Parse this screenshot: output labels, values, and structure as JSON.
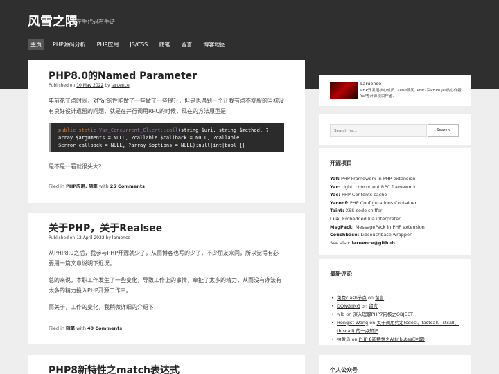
{
  "site": {
    "title": "风雪之隅",
    "description": "左手代码右手诗"
  },
  "nav": {
    "items": [
      {
        "label": "主页",
        "active": true
      },
      {
        "label": "PHP源码分析"
      },
      {
        "label": "PHP应用"
      },
      {
        "label": "JS/CSS"
      },
      {
        "label": "随笔"
      },
      {
        "label": "留言"
      },
      {
        "label": "博客地图"
      }
    ]
  },
  "posts": [
    {
      "title": "PHP8.0的Named Parameter",
      "meta_prefix": "Published on",
      "date": "10 May 2022",
      "meta_by": "by",
      "author": "laruence",
      "paragraphs": [
        "年前花了点时间，对Yar的性能做了一些做了一些提升，但是也遇到一个让我有点不舒服的当初没有良好设计遗留的问题，就是在并行调用RPC的时候，现在的方法原型是:"
      ],
      "code": {
        "line1_kw": "public static",
        "line1_fn": "Yar_Concurrent_Client::call",
        "line1_rest": "(string $uri, string $method, ?array $arguments = NULL, ?callable $callback = NULL, ?callable $error_callback = NULL, ?array $options = NULL):null|int|bool {}"
      },
      "after_code": "是不是一看就很头大？",
      "footer_prefix": "Filed in",
      "footer_cats": "PHP应用, 随笔",
      "footer_with": "with",
      "footer_comments": "25 Comments"
    },
    {
      "title": "关于PHP，关于Realsee",
      "meta_prefix": "Published on",
      "date": "12 April 2022",
      "meta_by": "by",
      "author": "laruence",
      "paragraphs": [
        "从PHP8.0之后，我参与PHP开源就少了，从而博客也写的少了，不少朋友来问，所以觉得有必要用一篇文章说明下近况。",
        "总的来说，本职工作发生了一些变化，导致工作上的事情，牵扯了太多的精力，从而没有办法有太多的精力投入PHP开源工作中。",
        "而关于，工作的变化，我稍微详细的介绍下:"
      ],
      "footer_prefix": "Filed in",
      "footer_cats": "随笔",
      "footer_with": "with",
      "footer_comments": "40 Comments"
    },
    {
      "title": "PHP8新特性之match表达式"
    }
  ],
  "sidebar": {
    "profile": {
      "name": "Laruence",
      "description": "PHP开发组核心成员, Zend顾问, PHP7及PHP8 JIT核心作者, Yaf等开源项目作者."
    },
    "search": {
      "placeholder": "Search for...",
      "button": "Search"
    },
    "projects": {
      "title": "开源项目",
      "items": [
        {
          "name": "Yaf:",
          "desc": "PHP Framework in PHP extension"
        },
        {
          "name": "Yar:",
          "desc": "Light, concurrent RPC framework"
        },
        {
          "name": "Yac:",
          "desc": "PHP Contents cache"
        },
        {
          "name": "Yaconf:",
          "desc": "PHP Configurations Container"
        },
        {
          "name": "Taint:",
          "desc": "XSS code sniffer"
        },
        {
          "name": "Lua:",
          "desc": "Embedded lua interpreter"
        },
        {
          "name": "MsgPack:",
          "desc": "MessagePack in PHP extension"
        },
        {
          "name": "Couchbase:",
          "desc": "Libcouchbase wrapper"
        },
        {
          "name": "See also:",
          "desc": "laruence@github"
        }
      ]
    },
    "comments": {
      "title": "最新评论",
      "items": [
        {
          "author": "免费clash节点",
          "on": "on",
          "post": "留言"
        },
        {
          "author": "DONGJING",
          "on": "on",
          "post": "留言"
        },
        {
          "author": "wlb",
          "on": "on",
          "post": "深入理解PHP7内核之OBJECT"
        },
        {
          "author": "Hengist Wang",
          "on": "on",
          "post": "关于调用约定(cdecl、fastcall、stcall、thiscall) 的一点知识"
        },
        {
          "author": "拍黄瓜",
          "on": "on",
          "post": "PHP 8新特性之Attributes(注解)"
        }
      ]
    },
    "wechat": {
      "title": "个人公众号"
    }
  }
}
